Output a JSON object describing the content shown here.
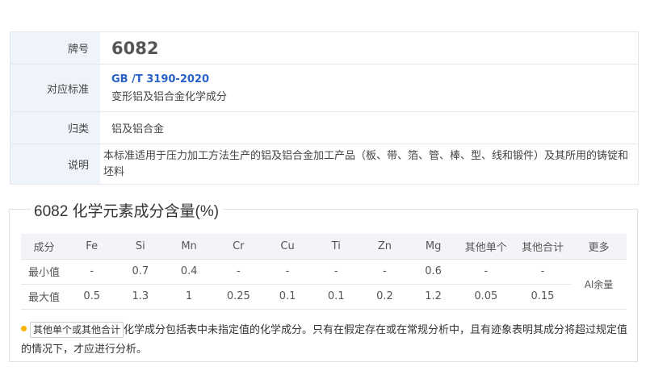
{
  "info": {
    "grade_label": "牌号",
    "grade_value": "6082",
    "standard_label": "对应标准",
    "standard_code": "GB /T 3190-2020",
    "standard_name": "变形铝及铝合金化学成分",
    "category_label": "归类",
    "category_value": "铝及铝合金",
    "desc_label": "说明",
    "desc_value": "本标准适用于压力加工方法生产的铝及铝合金加工产品（板、带、箔、管、棒、型、线和锻件）及其所用的铸锭和坯料"
  },
  "composition": {
    "title": "6082 化学元素成分含量(%)",
    "headers": [
      "成分",
      "Fe",
      "Si",
      "Mn",
      "Cr",
      "Cu",
      "Ti",
      "Zn",
      "Mg",
      "其他单个",
      "其他合计",
      "更多"
    ],
    "rows": [
      {
        "label": "最小值",
        "cells": [
          "-",
          "0.7",
          "0.4",
          "-",
          "-",
          "-",
          "-",
          "0.6",
          "-",
          "-"
        ]
      },
      {
        "label": "最大值",
        "cells": [
          "0.5",
          "1.3",
          "1",
          "0.25",
          "0.1",
          "0.1",
          "0.2",
          "1.2",
          "0.05",
          "0.15"
        ]
      }
    ],
    "more_value": "Al余量"
  },
  "note": {
    "chip": "其他单个或其他合计",
    "text": "化学成分包括表中未指定值的化学成分。只有在假定存在或在常规分析中，且有迹象表明其成分将超过规定值的情况下，才应进行分析。",
    "dot_color": "#f5b400"
  }
}
